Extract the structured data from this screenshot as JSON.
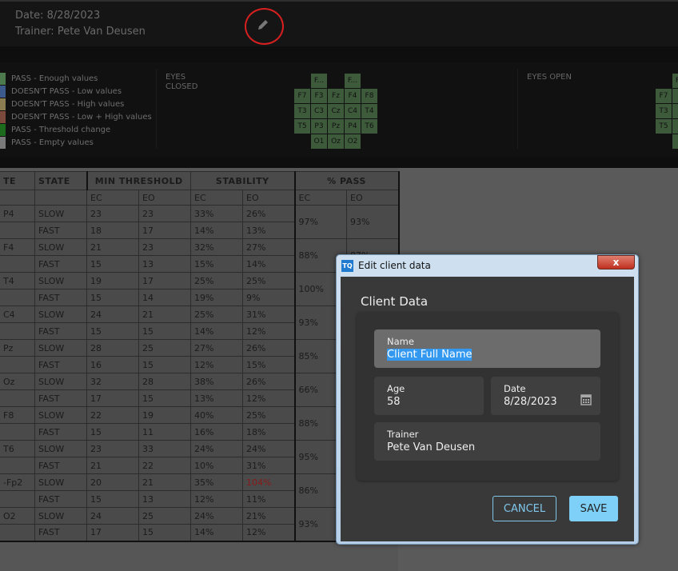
{
  "header": {
    "date": "Date: 8/28/2023",
    "trainer": "Trainer: Pete Van Deusen",
    "edit_icon": "pencil-icon"
  },
  "legend": [
    {
      "label": "PASS - Enough values",
      "color": "#4c7a4c"
    },
    {
      "label": "DOESN'T PASS - Low values",
      "color": "#3c5a8c"
    },
    {
      "label": "DOESN'T PASS - High values",
      "color": "#8c7c52"
    },
    {
      "label": "DOESN'T PASS - Low + High values",
      "color": "#7c4a3c"
    },
    {
      "label": "PASS - Threshold change",
      "color": "#1c6a1c"
    },
    {
      "label": "PASS - Empty values",
      "color": "#7a7a7a"
    }
  ],
  "eyes_closed": {
    "label": "EYES\nCLOSED",
    "rows": [
      [
        "",
        "F...",
        "",
        "F...",
        ""
      ],
      [
        "F7",
        "F3",
        "Fz",
        "F4",
        "F8"
      ],
      [
        "T3",
        "C3",
        "Cz",
        "C4",
        "T4"
      ],
      [
        "T5",
        "P3",
        "Pz",
        "P4",
        "T6"
      ],
      [
        "",
        "O1",
        "Oz",
        "O2",
        ""
      ]
    ]
  },
  "eyes_open": {
    "label": "EYES OPEN",
    "rows": [
      [
        "",
        "F..."
      ],
      [
        "F7",
        "F"
      ],
      [
        "T3",
        "C"
      ],
      [
        "T5",
        "P"
      ],
      [
        "",
        "O"
      ]
    ]
  },
  "table": {
    "headers": [
      "TE",
      "STATE",
      "MIN THRESHOLD",
      "STABILITY",
      "% PASS"
    ],
    "sub": [
      "EC",
      "EO",
      "EC",
      "EO",
      "EC",
      "EO"
    ],
    "groups": [
      {
        "site": "P4",
        "pass_ec": "97%",
        "pass_eo": "93%",
        "rows": [
          [
            "SLOW",
            "23",
            "23",
            "33%",
            "26%"
          ],
          [
            "FAST",
            "18",
            "17",
            "14%",
            "13%"
          ]
        ]
      },
      {
        "site": "F4",
        "pass_ec": "88%",
        "pass_eo": "87%",
        "rows": [
          [
            "SLOW",
            "21",
            "23",
            "32%",
            "27%"
          ],
          [
            "FAST",
            "15",
            "13",
            "15%",
            "14%"
          ]
        ]
      },
      {
        "site": "T4",
        "pass_ec": "100%",
        "pass_eo": "",
        "rows": [
          [
            "SLOW",
            "19",
            "17",
            "25%",
            "25%"
          ],
          [
            "FAST",
            "15",
            "14",
            "19%",
            "9%"
          ]
        ]
      },
      {
        "site": "C4",
        "pass_ec": "93%",
        "pass_eo": "",
        "rows": [
          [
            "SLOW",
            "24",
            "21",
            "25%",
            "31%"
          ],
          [
            "FAST",
            "15",
            "15",
            "14%",
            "12%"
          ]
        ]
      },
      {
        "site": "Pz",
        "pass_ec": "85%",
        "pass_eo": "",
        "rows": [
          [
            "SLOW",
            "28",
            "25",
            "27%",
            "26%"
          ],
          [
            "FAST",
            "16",
            "15",
            "12%",
            "15%"
          ]
        ]
      },
      {
        "site": "Oz",
        "pass_ec": "66%",
        "pass_eo": "",
        "rows": [
          [
            "SLOW",
            "32",
            "28",
            "38%",
            "26%"
          ],
          [
            "FAST",
            "17",
            "15",
            "13%",
            "12%"
          ]
        ]
      },
      {
        "site": "F8",
        "pass_ec": "88%",
        "pass_eo": "",
        "rows": [
          [
            "SLOW",
            "22",
            "19",
            "40%",
            "25%"
          ],
          [
            "FAST",
            "15",
            "11",
            "16%",
            "18%"
          ]
        ]
      },
      {
        "site": "T6",
        "pass_ec": "95%",
        "pass_eo": "",
        "rows": [
          [
            "SLOW",
            "23",
            "33",
            "24%",
            "24%"
          ],
          [
            "FAST",
            "21",
            "22",
            "10%",
            "31%"
          ]
        ]
      },
      {
        "site": "-Fp2",
        "pass_ec": "86%",
        "pass_eo": "",
        "rows": [
          [
            "SLOW",
            "20",
            "21",
            "35%",
            "104%"
          ],
          [
            "FAST",
            "15",
            "13",
            "12%",
            "11%"
          ]
        ]
      },
      {
        "site": "O2",
        "pass_ec": "93%",
        "pass_eo": "",
        "rows": [
          [
            "SLOW",
            "24",
            "25",
            "24%",
            "21%"
          ],
          [
            "FAST",
            "17",
            "15",
            "14%",
            "12%"
          ]
        ]
      }
    ]
  },
  "dialog": {
    "title": "Edit client data",
    "close": "x",
    "heading": "Client Data",
    "name_label": "Name",
    "name_value": "Client Full Name",
    "age_label": "Age",
    "age_value": "58",
    "date_label": "Date",
    "date_value": "8/28/2023",
    "trainer_label": "Trainer",
    "trainer_value": "Pete Van Deusen",
    "cancel": "CANCEL",
    "save": "SAVE",
    "accent": "#7fd0f8"
  }
}
